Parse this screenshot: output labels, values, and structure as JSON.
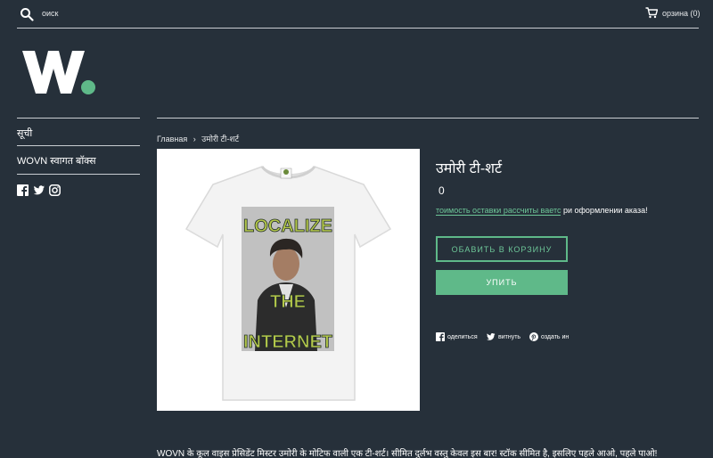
{
  "header": {
    "search_placeholder": "оиск",
    "cart_label": "орзина (0)"
  },
  "sidebar": {
    "items": [
      {
        "label": "सूची"
      },
      {
        "label": "WOVN स्वागत बॉक्स"
      }
    ],
    "social": [
      "facebook-icon",
      "twitter-icon",
      "instagram-icon"
    ]
  },
  "breadcrumb": {
    "home": "Главная",
    "separator": "›",
    "current": "उमोरी टी-शर्ट"
  },
  "product": {
    "title": "उमोरी टी-शर्ट",
    "price": "0",
    "shipping_link": "тоимость оставки рассчиты ваетс",
    "shipping_rest": "ри оформлении аказа!",
    "add_to_cart": "ОБАВИТЬ В КОРЗИНУ",
    "buy_now": "УПИТЬ",
    "image_text_top": "LOCALIZE",
    "image_text_mid": "THE",
    "image_text_bottom": "INTERNET",
    "description": "WOVN के कूल वाइस प्रेसिडेंट मिस्टर उमोरी के मोटिफ वाली एक टी-शर्ट। सीमित दुर्लभ वस्तु केवल इस बार! स्टॉक सीमित है, इसलिए पहले आओ, पहले पाओ!"
  },
  "share": {
    "facebook": "оделиться",
    "twitter": "витнуть",
    "pinterest": "оздать ин"
  },
  "colors": {
    "background": "#26303a",
    "accent": "#5fb989",
    "link": "#6dc698"
  }
}
